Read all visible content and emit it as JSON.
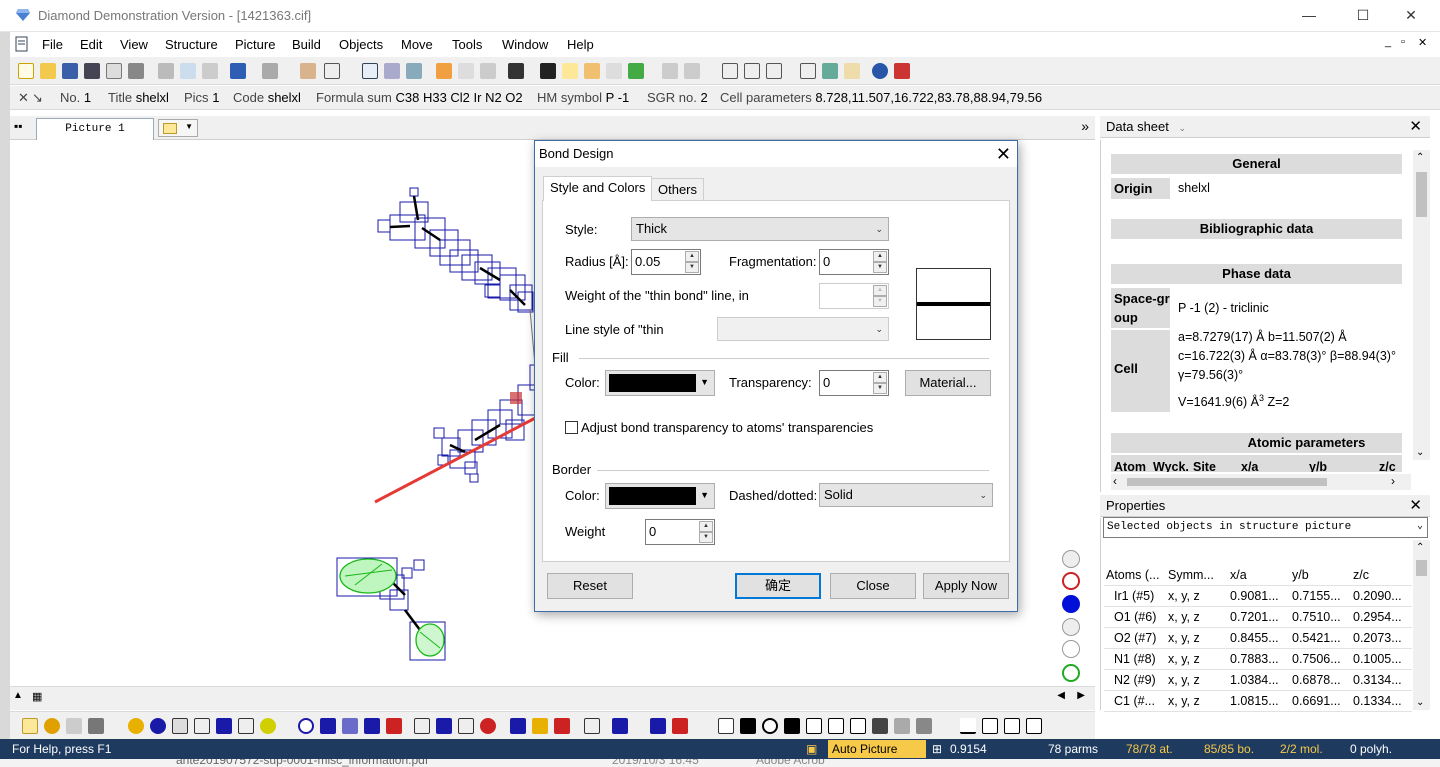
{
  "window": {
    "title": "Diamond Demonstration Version - [1421363.cif]",
    "minimize": "—",
    "maximize": "☐",
    "close": "✕"
  },
  "menu": [
    "File",
    "Edit",
    "View",
    "Structure",
    "Picture",
    "Build",
    "Objects",
    "Move",
    "Tools",
    "Window",
    "Help"
  ],
  "mdi_controls": {
    "min": "_",
    "restore": "▫",
    "close": "✕"
  },
  "infobar": {
    "no_label": "No.",
    "no": "1",
    "title_label": "Title",
    "title": "shelxl",
    "pics_label": "Pics",
    "pics": "1",
    "code_label": "Code",
    "code": "shelxl",
    "formula_label": "Formula sum",
    "formula": "C38 H33 Cl2 Ir N2 O2",
    "hm_label": "HM symbol",
    "hm": "P -1",
    "sgr_label": "SGR no.",
    "sgr": "2",
    "cell_label": "Cell parameters",
    "cell": "8.728,11.507,16.722,83.78,88.94,79.56"
  },
  "doc_tab": {
    "label": "Picture 1",
    "overflow": "»"
  },
  "data_sheet": {
    "title": "Data sheet",
    "close": "✕",
    "general": "General",
    "origin_label": "Origin",
    "origin": "shelxl",
    "biblio": "Bibliographic data",
    "phase": "Phase data",
    "space_group_label": "Space-group",
    "space_group": "P -1 (2) - triclinic",
    "cell_label": "Cell",
    "cell_line1": "a=8.7279(17) Å b=11.507(2) Å",
    "cell_line2": "c=16.722(3) Å α=83.78(3)° β=88.94(3)°",
    "cell_line3": "γ=79.56(3)°",
    "cell_line4": "V=1641.9(6) Å",
    "cell_line4_sup": "3",
    "cell_line4_end": " Z=2",
    "atomic": "Atomic parameters",
    "atomic_cols": [
      "Atom",
      "Wyck.",
      "Site",
      "x/a",
      "y/b",
      "z/c"
    ]
  },
  "properties": {
    "title": "Properties",
    "close": "✕",
    "selector": "Selected objects in structure picture",
    "columns": [
      "Atoms (...",
      "Symm...",
      "x/a",
      "y/b",
      "z/c"
    ],
    "rows": [
      [
        "Ir1 (#5)",
        "x, y, z",
        "0.9081...",
        "0.7155...",
        "0.2090..."
      ],
      [
        "O1 (#6)",
        "x, y, z",
        "0.7201...",
        "0.7510...",
        "0.2954..."
      ],
      [
        "O2 (#7)",
        "x, y, z",
        "0.8455...",
        "0.5421...",
        "0.2073..."
      ],
      [
        "N1 (#8)",
        "x, y, z",
        "0.7883...",
        "0.7506...",
        "0.1005..."
      ],
      [
        "N2 (#9)",
        "x, y, z",
        "1.0384...",
        "0.6878...",
        "0.3134..."
      ],
      [
        "C1 (#...",
        "x, y, z",
        "1.0815...",
        "0.6691...",
        "0.1334..."
      ]
    ]
  },
  "dialog": {
    "title": "Bond Design",
    "close": "✕",
    "tabs": [
      "Style and Colors",
      "Others"
    ],
    "style_label": "Style:",
    "style_value": "Thick",
    "radius_label": "Radius [Å]:",
    "radius_value": "0.05",
    "fragmentation_label": "Fragmentation:",
    "fragmentation_value": "0",
    "thin_weight_label": "Weight of the \"thin bond\" line, in",
    "thin_style_label": "Line style of \"thin",
    "fill_label": "Fill",
    "fill_color_label": "Color:",
    "fill_color": "#000000",
    "transparency_label": "Transparency:",
    "transparency_value": "0",
    "material_button": "Material...",
    "adjust_label": "Adjust bond transparency to atoms' transparencies",
    "border_label": "Border",
    "border_color_label": "Color:",
    "border_color": "#000000",
    "dashed_label": "Dashed/dotted:",
    "dashed_value": "Solid",
    "weight_label": "Weight",
    "weight_value": "0",
    "reset_button": "Reset",
    "ok_button": "确定",
    "close_button": "Close",
    "apply_button": "Apply Now"
  },
  "status": {
    "help": "For Help, press F1",
    "auto_picture": "Auto Picture",
    "zoom": "0.9154",
    "parms": "78 parms",
    "atoms": "78/78 at.",
    "bonds": "85/85 bo.",
    "mol": "2/2 mol.",
    "polyh": "0 polyh."
  },
  "taskbar": {
    "file": "ante201907572-sup-0001-misc_information.pdf",
    "date": "2019/10/3 16:45",
    "app": "Adobe Acrob"
  },
  "colors": {
    "accent": "#0078d7",
    "status_bg": "#1e3a5f",
    "annotation_arrow": "#e53935",
    "status_highlight": "#f7c948"
  }
}
